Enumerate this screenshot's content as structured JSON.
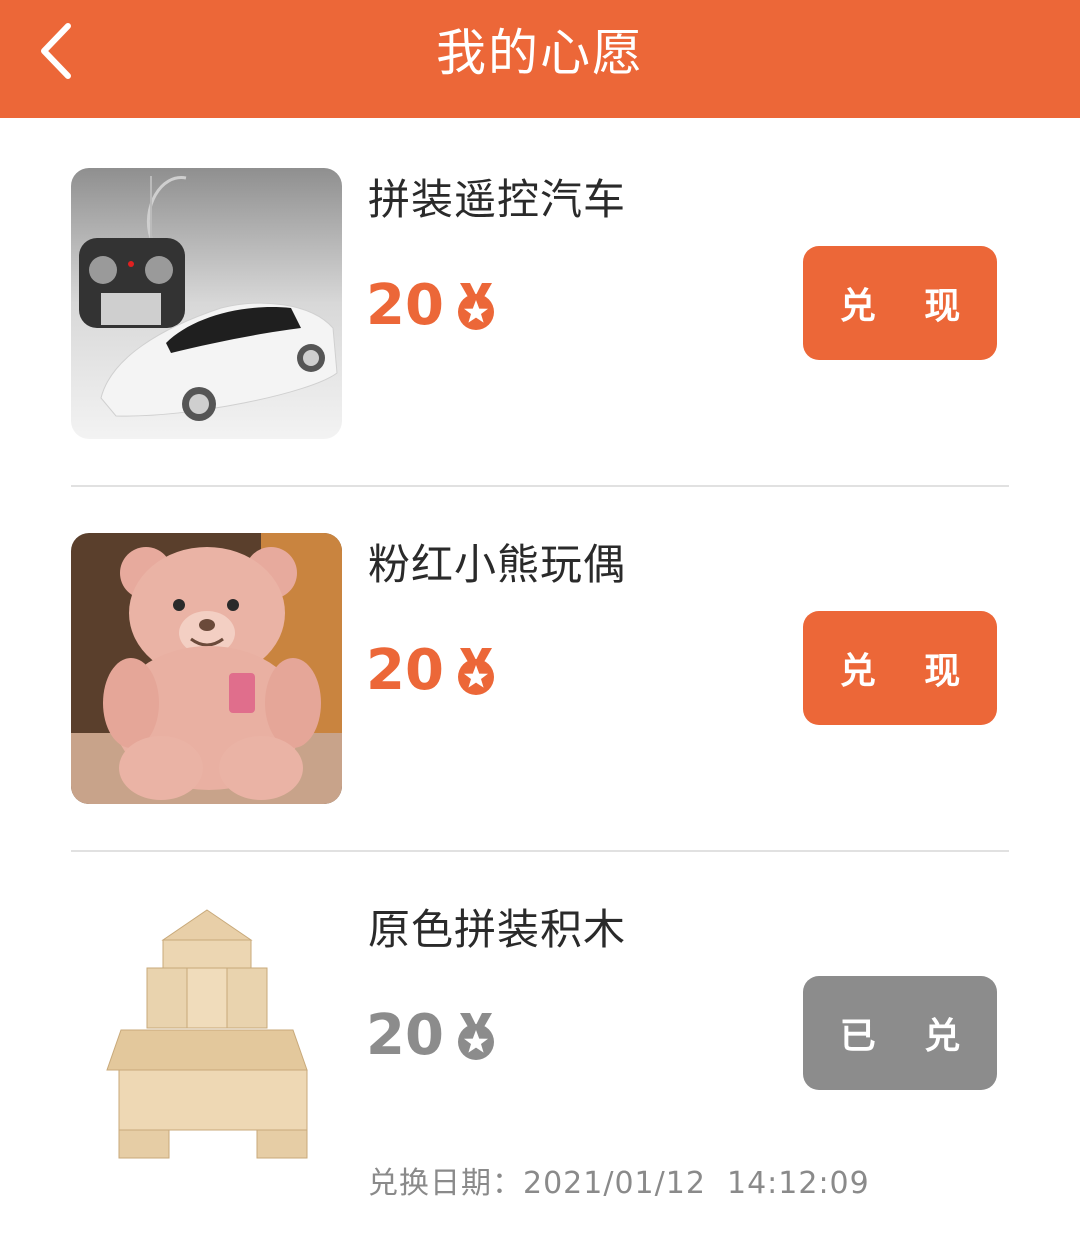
{
  "header": {
    "title": "我的心愿"
  },
  "colors": {
    "accent": "#EC6738",
    "redeemed": "#8C8C8C",
    "text": "#2A2A2A"
  },
  "items": [
    {
      "name": "拼装遥控汽车",
      "points": "20",
      "icon": "medal-icon",
      "action": "兑 现",
      "status": "available"
    },
    {
      "name": "粉红小熊玩偶",
      "points": "20",
      "icon": "medal-icon",
      "action": "兑 现",
      "status": "available"
    },
    {
      "name": "原色拼装积木",
      "points": "20",
      "icon": "medal-icon",
      "action": "已 兑",
      "status": "redeemed",
      "date_label": "兑换日期：",
      "date_value": "2021/01/12  14:12:09"
    }
  ]
}
